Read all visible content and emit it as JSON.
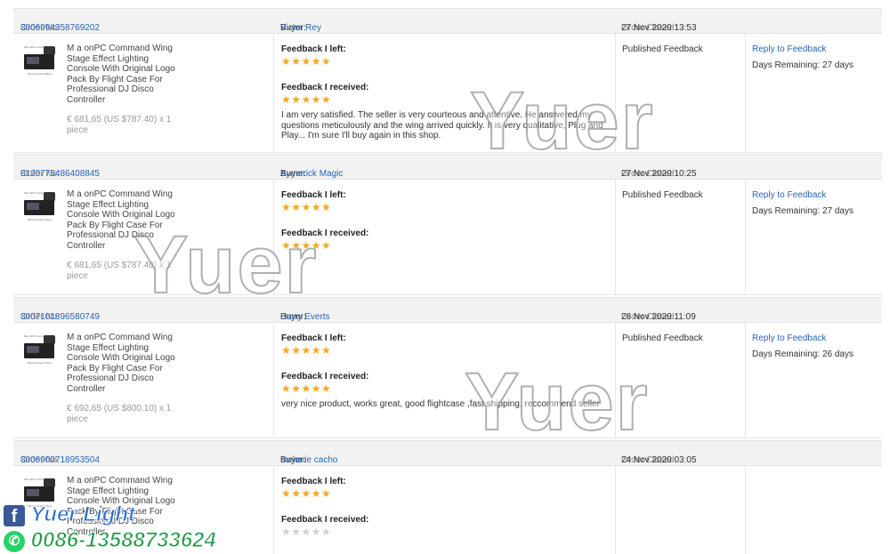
{
  "labels": {
    "order_no": "Order No:",
    "buyer": "Buyer:",
    "order_closed": "Order Closed:",
    "feedback_left": "Feedback I left:",
    "feedback_received": "Feedback I received:",
    "published": "Published Feedback",
    "reply": "Reply to Feedback",
    "days_remaining": "Days Remaining:"
  },
  "product_image": {
    "caption_top": "MA onPC Controller",
    "caption_bottom": "MA Command Wing"
  },
  "orders": [
    {
      "order_no": "3006994358769202",
      "buyer": "Victor Rey",
      "closed": "27 Nov 2020 13:53",
      "product": "M a onPC Command Wing Stage Effect Lighting Console With Original Logo Pack By Flight Case For Professional DJ Disco Controller",
      "price": "€ 681,65 (US $787.40) x 1 piece",
      "left_stars": "★★★★★",
      "received_stars": "★★★★★",
      "comment": "I am very satisfied. The seller is very courteous and attentive. He answered my questions meticulously and the wing arrived quickly. It is very qualitative, Plug and Play... I'm sure I'll buy again in this shop.",
      "status": "Published Feedback",
      "reply": "Reply to Feedback",
      "days": "27 days"
    },
    {
      "order_no": "8120775486408845",
      "buyer": "Aymerick Magic",
      "closed": "27 Nov 2020 10:25",
      "product": "M a onPC Command Wing Stage Effect Lighting Console With Original Logo Pack By Flight Case For Professional DJ Disco Controller",
      "price": "€ 681,65 (US $787.40) x 1 piece",
      "left_stars": "★★★★★",
      "received_stars": "★★★★★",
      "comment": "",
      "status": "Published Feedback",
      "reply": "Reply to Feedback",
      "days": "27 days"
    },
    {
      "order_no": "3007101896580749",
      "buyer": "Harry Everts",
      "closed": "26 Nov 2020 11:09",
      "product": "M a onPC Command Wing Stage Effect Lighting Console With Original Logo Pack By Flight Case For Professional DJ Disco Controller",
      "price": "€ 692,65 (US $800.10) x 1 piece",
      "left_stars": "★★★★★",
      "received_stars": "★★★★★",
      "comment": "very nice product, works great, good flightcase ,fast shipping, reccommend seller",
      "status": "Published Feedback",
      "reply": "Reply to Feedback",
      "days": "26 days"
    },
    {
      "order_no": "3006900718953504",
      "buyer": "melanie cacho",
      "closed": "24 Nov 2020 03:05",
      "product": "M a onPC Command Wing Stage Effect Lighting Console With Original Logo Pack By Flight Case For Professional DJ Disco Controller",
      "price": "",
      "left_stars": "★★★★★",
      "received_stars": "★★★★★",
      "comment": "",
      "status": "",
      "reply": "",
      "days": ""
    }
  ],
  "watermark": "Yuer",
  "social": {
    "brand": "Yuer Light",
    "phone": "0086-13588733624",
    "facebook_icon": "facebook-icon",
    "whatsapp_icon": "whatsapp-icon"
  },
  "colors": {
    "link": "#2a64b4",
    "star": "#f5a623",
    "header_bg": "#f2f2f2"
  }
}
